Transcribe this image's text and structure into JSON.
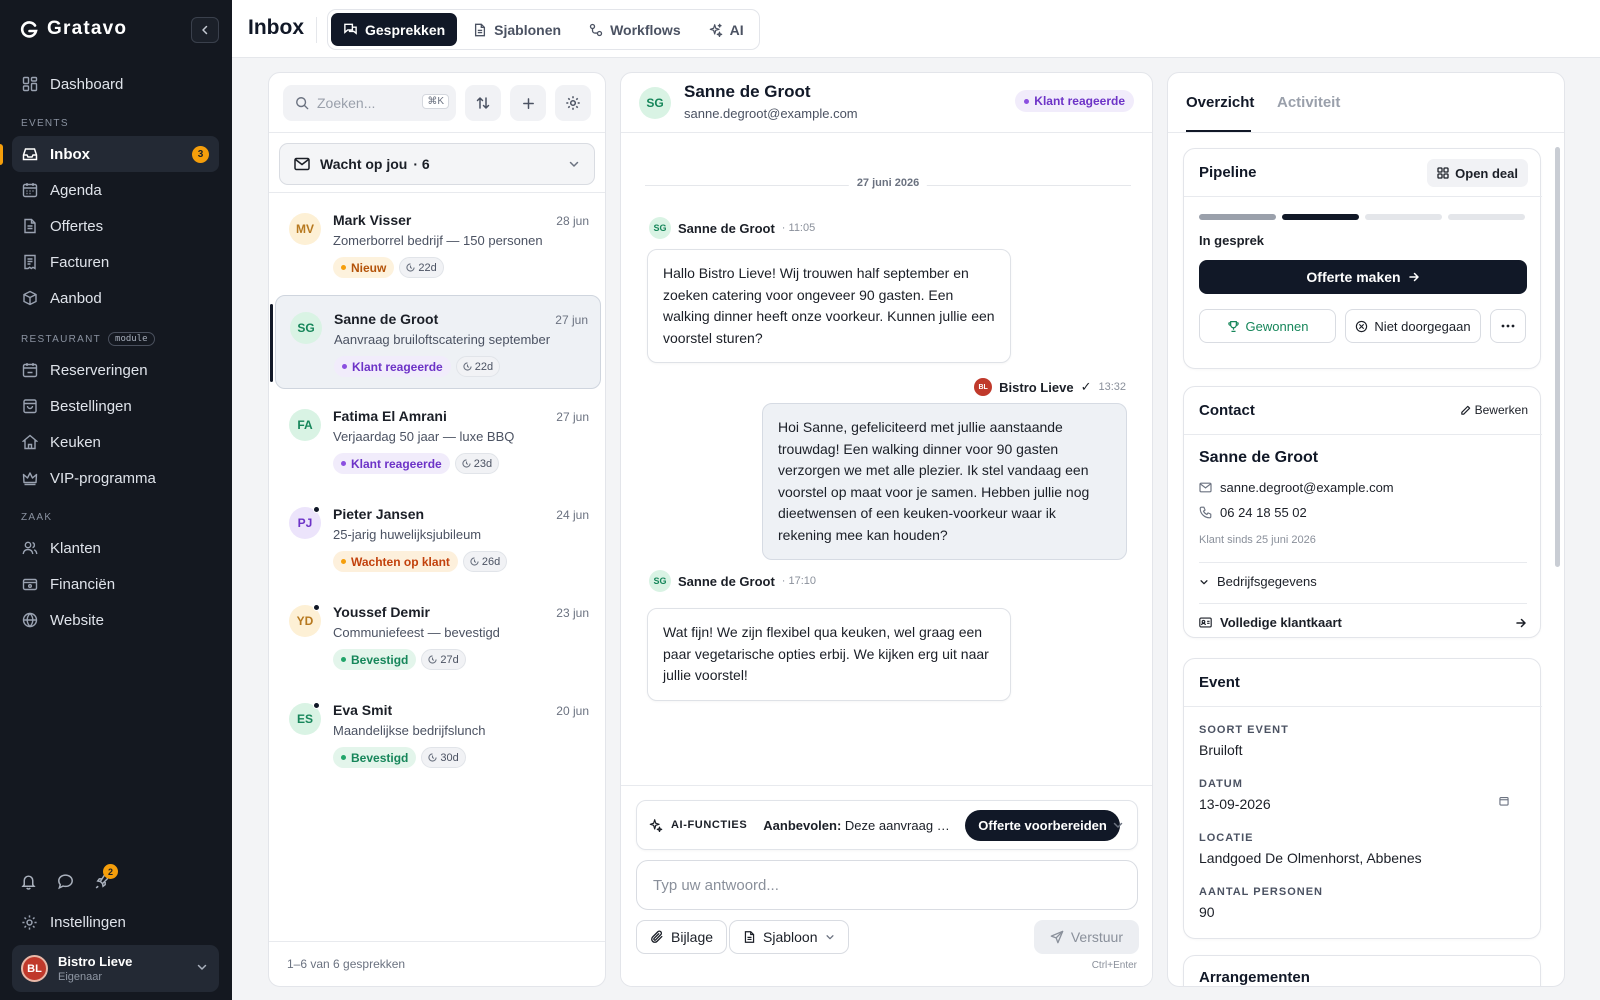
{
  "app": {
    "brand": "Gratavo"
  },
  "sidebar": {
    "nav_top": [
      {
        "label": "Dashboard",
        "icon": "dashboard-icon"
      }
    ],
    "section_events": "EVENTS",
    "events": [
      {
        "label": "Inbox",
        "icon": "inbox-icon",
        "badge": "3",
        "active": true
      },
      {
        "label": "Agenda",
        "icon": "calendar-icon"
      },
      {
        "label": "Offertes",
        "icon": "document-icon"
      },
      {
        "label": "Facturen",
        "icon": "invoice-icon"
      },
      {
        "label": "Aanbod",
        "icon": "package-icon"
      }
    ],
    "section_restaurant": "RESTAURANT",
    "module_pill": "module",
    "restaurant": [
      {
        "label": "Reserveringen",
        "icon": "calendar-check-icon"
      },
      {
        "label": "Bestellingen",
        "icon": "shopping-bag-icon"
      },
      {
        "label": "Keuken",
        "icon": "chef-hat-icon"
      },
      {
        "label": "VIP-programma",
        "icon": "crown-icon"
      }
    ],
    "section_zaak": "ZAAK",
    "zaak": [
      {
        "label": "Klanten",
        "icon": "users-icon"
      },
      {
        "label": "Financiën",
        "icon": "wallet-icon"
      },
      {
        "label": "Website",
        "icon": "globe-icon"
      }
    ],
    "bottom_badge": "2",
    "settings_label": "Instellingen",
    "user": {
      "logo_text": "BL",
      "name": "Bistro Lieve",
      "role": "Eigenaar"
    }
  },
  "topbar": {
    "title": "Inbox",
    "tabs": [
      {
        "label": "Gesprekken",
        "icon": "chat-icon",
        "active": true
      },
      {
        "label": "Sjablonen",
        "icon": "file-icon"
      },
      {
        "label": "Workflows",
        "icon": "workflow-icon"
      },
      {
        "label": "AI",
        "icon": "sparkle-icon"
      }
    ]
  },
  "list": {
    "search_placeholder": "Zoeken...",
    "search_shortcut": "⌘K",
    "filter_label": "Wacht op jou",
    "filter_count": "· 6",
    "conversations": [
      {
        "initials": "MV",
        "name": "Mark Visser",
        "date": "28 jun",
        "subject": "Zomerborrel bedrijf — 150 personen",
        "status": "Nieuw",
        "age": "22d",
        "unread": false
      },
      {
        "initials": "SG",
        "name": "Sanne de Groot",
        "date": "27 jun",
        "subject": "Aanvraag bruiloftscatering september",
        "status": "Klant reageerde",
        "age": "22d",
        "unread": false
      },
      {
        "initials": "FA",
        "name": "Fatima El Amrani",
        "date": "27 jun",
        "subject": "Verjaardag 50 jaar — luxe BBQ",
        "status": "Klant reageerde",
        "age": "23d",
        "unread": false
      },
      {
        "initials": "PJ",
        "name": "Pieter Jansen",
        "date": "24 jun",
        "subject": "25-jarig huwelijksjubileum",
        "status": "Wachten op klant",
        "age": "26d",
        "unread": true
      },
      {
        "initials": "YD",
        "name": "Youssef Demir",
        "date": "23 jun",
        "subject": "Communiefeest — bevestigd",
        "status": "Bevestigd",
        "age": "27d",
        "unread": true
      },
      {
        "initials": "ES",
        "name": "Eva Smit",
        "date": "20 jun",
        "subject": "Maandelijkse bedrijfslunch",
        "status": "Bevestigd",
        "age": "30d",
        "unread": true
      }
    ],
    "footer": "1–6 van 6 gesprekken"
  },
  "chat": {
    "initials": "SG",
    "name": "Sanne de Groot",
    "email": "sanne.degroot@example.com",
    "status": "Klant reageerde",
    "date_separator": "27 juni 2026",
    "messages": [
      {
        "sender": "Sanne de Groot",
        "initials": "SG",
        "time": "· 11:05",
        "text": "Hallo Bistro Lieve! Wij trouwen half september en zoeken catering voor ongeveer 90 gasten. Een walking dinner heeft onze voorkeur. Kunnen jullie een voorstel sturen?"
      },
      {
        "sender": "Bistro Lieve",
        "logo": "BL",
        "check": "✓",
        "time": "13:32",
        "text": "Hoi Sanne, gefeliciteerd met jullie aanstaande trouwdag! Een walking dinner voor 90 gasten verzorgen we met alle plezier. Ik stel vandaag een voorstel op maat voor je samen. Hebben jullie nog dieetwensen of een keuken-voorkeur waar ik rekening mee kan houden?"
      },
      {
        "sender": "Sanne de Groot",
        "initials": "SG",
        "time": "· 17:10",
        "text": "Wat fijn! We zijn flexibel qua keuken, wel graag een paar vegetarische opties erbij. We kijken erg uit naar jullie voorstel!"
      }
    ],
    "ai": {
      "label": "AI-FUNCTIES",
      "recommend_label": "Aanbevolen:",
      "recommend_text": "Deze aanvraag is ...",
      "action": "Offerte voorbereiden"
    },
    "reply_placeholder": "Typ uw antwoord...",
    "attach_label": "Bijlage",
    "template_label": "Sjabloon",
    "send_label": "Verstuur",
    "shortcut": "Ctrl+Enter"
  },
  "details": {
    "tabs": [
      {
        "label": "Overzicht",
        "active": true
      },
      {
        "label": "Activiteit"
      }
    ],
    "pipeline": {
      "title": "Pipeline",
      "open_deal": "Open deal",
      "stage_count": 4,
      "current_stage": 2,
      "stage_label": "In gesprek",
      "primary_action": "Offerte maken",
      "won_label": "Gewonnen",
      "lost_label": "Niet doorgegaan"
    },
    "contact": {
      "title": "Contact",
      "edit_label": "Bewerken",
      "name": "Sanne de Groot",
      "email": "sanne.degroot@example.com",
      "phone": "06 24 18 55 02",
      "since": "Klant sinds 25 juni 2026",
      "company_toggle": "Bedrijfsgegevens",
      "full_card": "Volledige klantkaart"
    },
    "event": {
      "title": "Event",
      "type_label": "SOORT EVENT",
      "type_value": "Bruiloft",
      "date_label": "DATUM",
      "date_value": "13-09-2026",
      "location_label": "LOCATIE",
      "location_value": "Landgoed De Olmenhorst, Abbenes",
      "guests_label": "AANTAL PERSONEN",
      "guests_value": "90"
    },
    "arrangements_title": "Arrangementen"
  },
  "colors": {
    "sidebar_bg": "#141820",
    "accent": "#f59e0b",
    "primary": "#111827",
    "status_new": "#d97706",
    "status_replied": "#6d33c7",
    "status_waiting": "#c2410c",
    "status_confirmed": "#16865a"
  }
}
